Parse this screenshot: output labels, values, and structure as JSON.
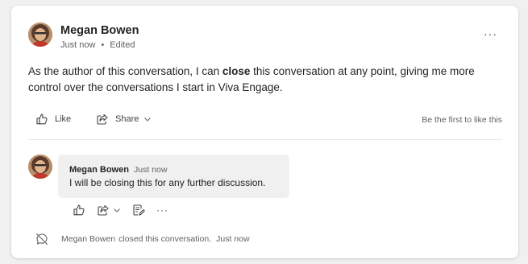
{
  "post": {
    "author": "Megan Bowen",
    "time": "Just now",
    "separator": "•",
    "edited": "Edited",
    "more": "···",
    "body_before": "As the author of this conversation, I can ",
    "body_bold": "close",
    "body_after": " this conversation at any point, giving me more control over the conversations I start in Viva Engage."
  },
  "actions": {
    "like": "Like",
    "share": "Share",
    "first_like": "Be the first to like this"
  },
  "reply": {
    "author": "Megan Bowen",
    "time": "Just now",
    "text": "I will be closing this for any further discussion.",
    "more": "···"
  },
  "closed_notice": {
    "author": "Megan Bowen",
    "text": "closed this conversation.",
    "time": "Just now"
  },
  "icons": {
    "avatar": "avatar-photo",
    "like": "thumbs-up-icon",
    "share": "share-icon",
    "chevron": "chevron-down-icon",
    "edit": "edit-note-icon",
    "closed": "closed-chat-icon"
  },
  "colors": {
    "background": "#f0f0f0",
    "card": "#ffffff",
    "bubble": "#f0f0f0",
    "text": "#242424",
    "muted": "#616161"
  }
}
